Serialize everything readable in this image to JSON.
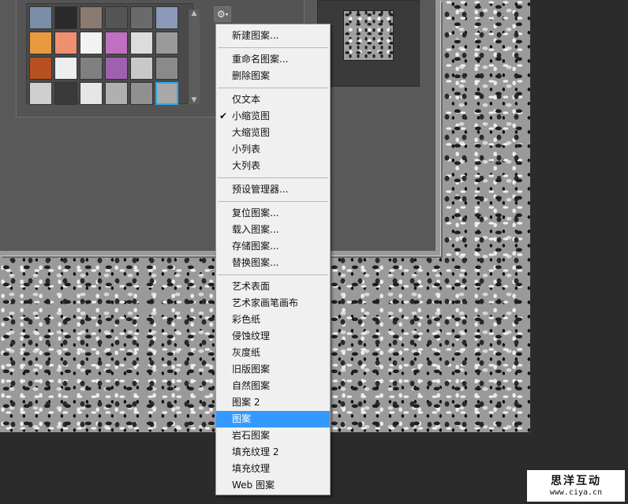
{
  "swatches": [
    {
      "name": "swatch-bubbles",
      "bg": "#7a8ea8"
    },
    {
      "name": "swatch-plaid",
      "bg": "#2a2a2a"
    },
    {
      "name": "swatch-bricks-dark",
      "bg": "#8a7a70"
    },
    {
      "name": "swatch-zebra",
      "bg": "#555555"
    },
    {
      "name": "swatch-gravel",
      "bg": "#6a6a6a"
    },
    {
      "name": "swatch-blue-grey",
      "bg": "#8a9ab8"
    },
    {
      "name": "swatch-orange-weave",
      "bg": "#e89a40"
    },
    {
      "name": "swatch-salmon-grid",
      "bg": "#f09070"
    },
    {
      "name": "swatch-white-grid",
      "bg": "#f2f2f2"
    },
    {
      "name": "swatch-rainbow",
      "bg": "#c070c0"
    },
    {
      "name": "swatch-speckle",
      "bg": "#dcdcdc"
    },
    {
      "name": "swatch-cobble",
      "bg": "#9a9a9a"
    },
    {
      "name": "swatch-rust",
      "bg": "#b85020"
    },
    {
      "name": "swatch-concentric",
      "bg": "#eeeeee"
    },
    {
      "name": "swatch-checker",
      "bg": "#808080"
    },
    {
      "name": "swatch-purple-mix",
      "bg": "#a060b0"
    },
    {
      "name": "swatch-noise",
      "bg": "#c8c8c8"
    },
    {
      "name": "swatch-stones",
      "bg": "#8a8a8a"
    },
    {
      "name": "swatch-dots",
      "bg": "#cfcfcf"
    },
    {
      "name": "swatch-stripe-noise",
      "bg": "#3a3a3a"
    },
    {
      "name": "swatch-white-bricks",
      "bg": "#e6e6e6"
    },
    {
      "name": "swatch-grey-cloud",
      "bg": "#b0b0b0"
    },
    {
      "name": "swatch-grey-blotch",
      "bg": "#909090"
    },
    {
      "name": "swatch-current-pattern",
      "bg": "#a8a8a8",
      "selected": true
    }
  ],
  "picker": {
    "scroll_up_glyph": "▲",
    "scroll_down_glyph": "▼",
    "gear_glyph": "⚙",
    "gear_caret": "▾"
  },
  "menu": {
    "groups": [
      [
        {
          "label": "新建图案..."
        }
      ],
      [
        {
          "label": "重命名图案..."
        },
        {
          "label": "删除图案"
        }
      ],
      [
        {
          "label": "仅文本"
        },
        {
          "label": "小缩览图",
          "checked": true
        },
        {
          "label": "大缩览图"
        },
        {
          "label": "小列表"
        },
        {
          "label": "大列表"
        }
      ],
      [
        {
          "label": "预设管理器..."
        }
      ],
      [
        {
          "label": "复位图案..."
        },
        {
          "label": "载入图案..."
        },
        {
          "label": "存储图案..."
        },
        {
          "label": "替换图案..."
        }
      ],
      [
        {
          "label": "艺术表面"
        },
        {
          "label": "艺术家画笔画布"
        },
        {
          "label": "彩色纸"
        },
        {
          "label": "侵蚀纹理"
        },
        {
          "label": "灰度纸"
        },
        {
          "label": "旧版图案"
        },
        {
          "label": "自然图案"
        },
        {
          "label": "图案 2"
        },
        {
          "label": "图案",
          "highlighted": true
        },
        {
          "label": "岩石图案"
        },
        {
          "label": "填充纹理 2"
        },
        {
          "label": "填充纹理"
        },
        {
          "label": "Web 图案"
        }
      ]
    ],
    "check_glyph": "✔"
  },
  "watermark": {
    "title": "思洋互动",
    "url": "www.ciya.cn"
  }
}
